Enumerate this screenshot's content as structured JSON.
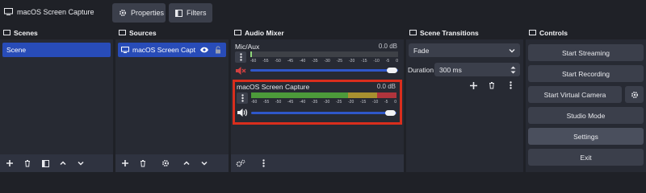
{
  "topbar": {
    "source_name": "macOS Screen Capture",
    "properties_label": "Properties",
    "filters_label": "Filters"
  },
  "scenes": {
    "title": "Scenes",
    "items": [
      "Scene"
    ]
  },
  "sources": {
    "title": "Sources",
    "items": [
      "macOS Screen Capt"
    ]
  },
  "mixer": {
    "title": "Audio Mixer",
    "channels": [
      {
        "name": "Mic/Aux",
        "db": "0.0 dB",
        "muted": true
      },
      {
        "name": "macOS Screen Capture",
        "db": "0.0 dB",
        "muted": false
      }
    ],
    "ticks": [
      "-60",
      "-55",
      "-50",
      "-45",
      "-40",
      "-35",
      "-30",
      "-25",
      "-20",
      "-15",
      "-10",
      "-5",
      "0"
    ]
  },
  "transitions": {
    "title": "Scene Transitions",
    "transition": "Fade",
    "duration_label": "Duration",
    "duration_value": "300 ms"
  },
  "controls": {
    "title": "Controls",
    "start_streaming": "Start Streaming",
    "start_recording": "Start Recording",
    "start_virtual_camera": "Start Virtual Camera",
    "studio_mode": "Studio Mode",
    "settings": "Settings",
    "exit": "Exit"
  },
  "colors": {
    "accent": "#284cb8",
    "highlight": "#d92e1d",
    "meter_green": "#4c9a3a",
    "meter_yellow": "#a8902f",
    "meter_red": "#b0343c",
    "slider": "#2f57c9"
  }
}
